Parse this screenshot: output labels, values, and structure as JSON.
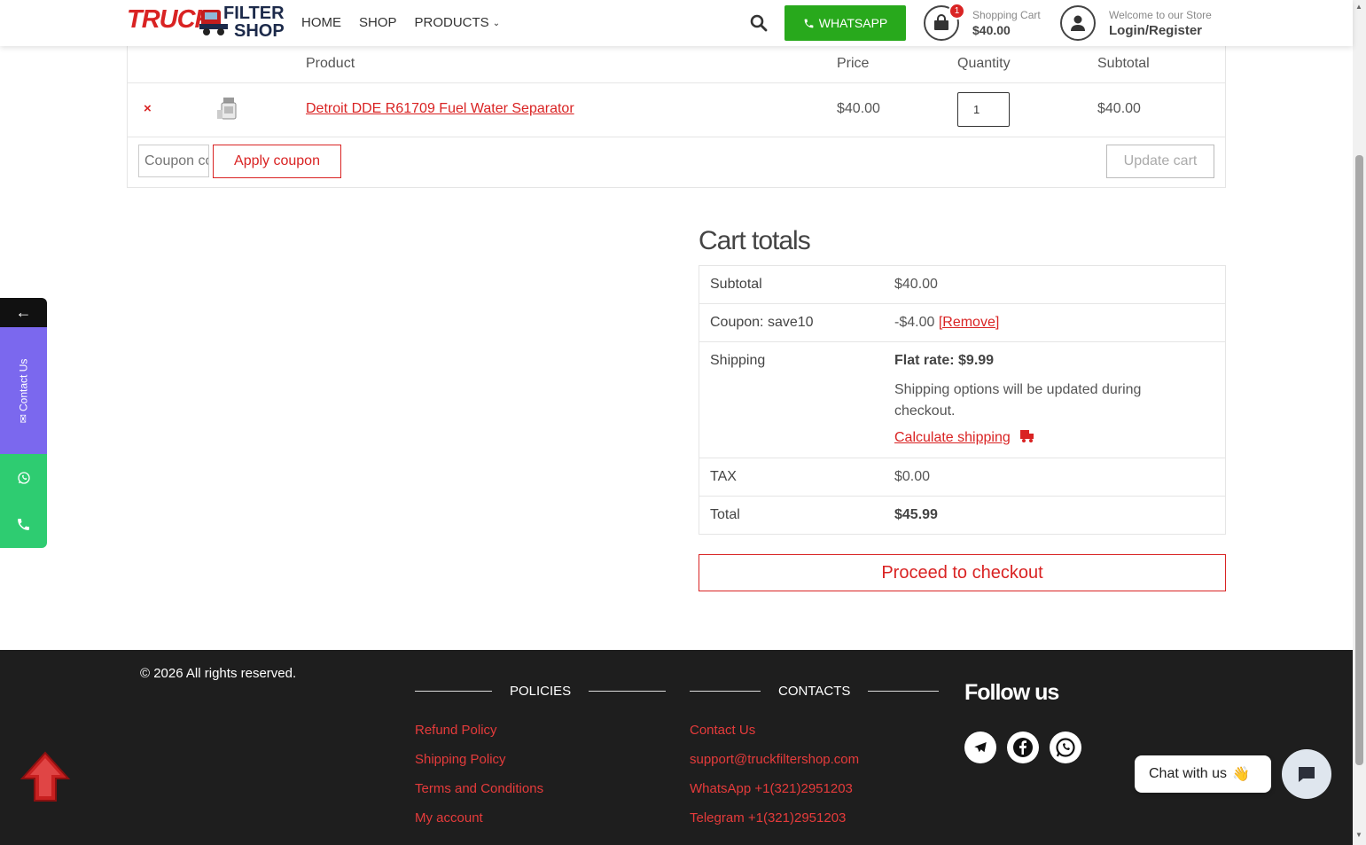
{
  "header": {
    "logo": {
      "word1": "TRUCK",
      "word2": "FILTER",
      "word3": "SHOP"
    },
    "nav": [
      {
        "label": "HOME"
      },
      {
        "label": "SHOP"
      },
      {
        "label": "PRODUCTS"
      }
    ],
    "whatsapp_label": "WHATSAPP",
    "cart": {
      "badge": "1",
      "label": "Shopping Cart",
      "amount": "$40.00"
    },
    "account": {
      "welcome": "Welcome to our Store",
      "login": "Login/Register"
    }
  },
  "cart_table": {
    "columns": {
      "product": "Product",
      "price": "Price",
      "quantity": "Quantity",
      "subtotal": "Subtotal"
    },
    "rows": [
      {
        "remove": "×",
        "product": "Detroit DDE R61709 Fuel Water Separator",
        "price": "$40.00",
        "quantity": "1",
        "subtotal": "$40.00"
      }
    ],
    "coupon_placeholder": "Coupon code",
    "apply_coupon": "Apply coupon",
    "update_cart": "Update cart"
  },
  "cart_totals": {
    "title": "Cart totals",
    "subtotal_label": "Subtotal",
    "subtotal_value": "$40.00",
    "coupon_label": "Coupon: save10",
    "coupon_value": "-$4.00",
    "coupon_remove": "[Remove]",
    "shipping_label": "Shipping",
    "shipping_rate": "Flat rate: $9.99",
    "shipping_note": "Shipping options will be updated during checkout.",
    "calculate_shipping": "Calculate shipping",
    "tax_label": "TAX",
    "tax_value": "$0.00",
    "total_label": "Total",
    "total_value": "$45.99",
    "checkout_label": "Proceed to checkout"
  },
  "side_widgets": {
    "back_arrow": "←",
    "contact_label": "✉ Contact Us"
  },
  "footer": {
    "copyright": "© 2026 All rights reserved.",
    "policies_title": "POLICIES",
    "policies": [
      "Refund Policy",
      "Shipping Policy",
      "Terms and Conditions",
      "My account"
    ],
    "contacts_title": "CONTACTS",
    "contacts": [
      "Contact Us",
      "support@truckfiltershop.com",
      "WhatsApp +1(321)2951203",
      "Telegram +1(321)2951203"
    ],
    "follow_title": "Follow us"
  },
  "chat": {
    "label": "Chat with us",
    "emoji": "👋"
  },
  "colors": {
    "accent": "#d92323",
    "whatsapp": "#28a91c",
    "contact_purple": "#7b68ee",
    "footer_bg": "#1e1e1e"
  }
}
